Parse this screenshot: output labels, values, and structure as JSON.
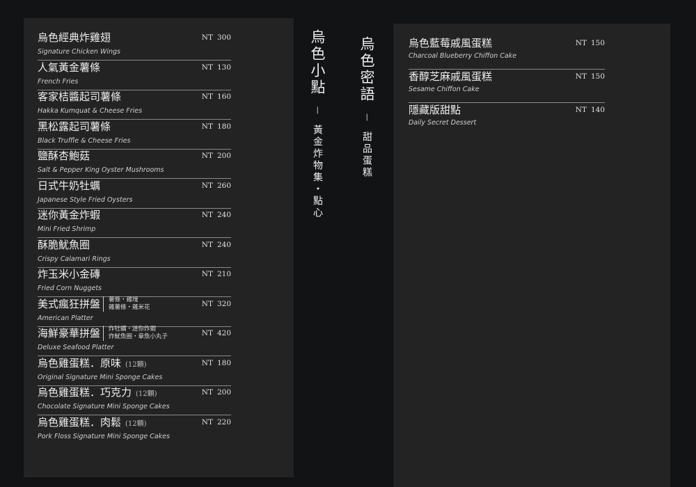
{
  "left_menu": {
    "items": [
      {
        "name": "烏色經典炸雞翅",
        "en": "Signature Chicken Wings",
        "currency": "NT",
        "price": "300"
      },
      {
        "name": "人氣黃金薯條",
        "en": "French Fries",
        "currency": "NT",
        "price": "130"
      },
      {
        "name": "客家桔醬起司薯條",
        "en": "Hakka Kumquat & Cheese Fries",
        "currency": "NT",
        "price": "160"
      },
      {
        "name": "黑松露起司薯條",
        "en": "Black Truffle & Cheese Fries",
        "currency": "NT",
        "price": "180"
      },
      {
        "name": "鹽酥杏鮑菇",
        "en": "Salt & Pepper King Oyster Mushrooms",
        "currency": "NT",
        "price": "200"
      },
      {
        "name": "日式牛奶牡蠣",
        "en": "Japanese Style Fried Oysters",
        "currency": "NT",
        "price": "260"
      },
      {
        "name": "迷你黃金炸蝦",
        "en": "Mini Fried Shrimp",
        "currency": "NT",
        "price": "240"
      },
      {
        "name": "酥脆魷魚圈",
        "en": "Crispy Calamari Rings",
        "currency": "NT",
        "price": "240"
      },
      {
        "name": "炸玉米小金磚",
        "en": "Fried Corn Nuggets",
        "currency": "NT",
        "price": "210"
      },
      {
        "name": "美式瘋狂拼盤",
        "en": "American Platter",
        "currency": "NT",
        "price": "320",
        "sub1": "薯條・雞塊",
        "sub2": "雞薯條・雞米花"
      },
      {
        "name": "海鮮豪華拼盤",
        "en": "Deluxe Seafood Platter",
        "currency": "NT",
        "price": "420",
        "sub1": "炸牡蠣・迷你炸蝦",
        "sub2": "炸魷魚圈・章魚小丸子"
      },
      {
        "name": "烏色雞蛋糕．原味",
        "count": "(12顆)",
        "en": "Original Signature Mini Sponge Cakes",
        "currency": "NT",
        "price": "180"
      },
      {
        "name": "烏色雞蛋糕．巧克力",
        "count": "(12顆)",
        "en": "Chocolate Signature Mini Sponge Cakes",
        "currency": "NT",
        "price": "200"
      },
      {
        "name": "烏色雞蛋糕．肉鬆",
        "count": "(12顆)",
        "en": "Pork Floss Signature Mini Sponge Cakes",
        "currency": "NT",
        "price": "220"
      }
    ]
  },
  "titles": {
    "snacks": {
      "main": "烏色小點",
      "dash": "—",
      "sub": "黃金炸物集・點心"
    },
    "desserts": {
      "main": "烏色密語",
      "dash": "—",
      "sub": "甜品蛋糕"
    }
  },
  "right_menu": {
    "items": [
      {
        "name": "烏色藍莓戚風蛋糕",
        "en": "Charcoal Blueberry Chiffon Cake",
        "currency": "NT",
        "price": "150"
      },
      {
        "name": "香醇芝麻戚風蛋糕",
        "en": "Sesame Chiffon Cake",
        "currency": "NT",
        "price": "150"
      },
      {
        "name": "隱藏版甜點",
        "en": "Daily Secret Dessert",
        "currency": "NT",
        "price": "140"
      }
    ]
  }
}
